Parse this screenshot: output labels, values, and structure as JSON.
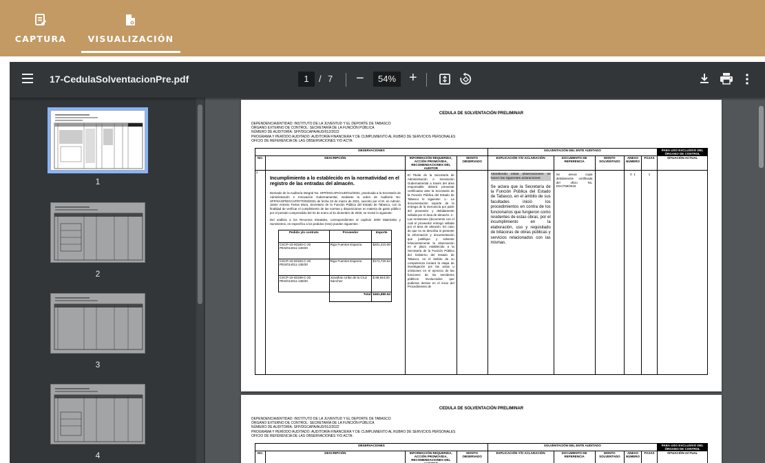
{
  "appbar": {
    "tabs": [
      {
        "label": "CAPTURA",
        "icon": "edit-document-icon",
        "active": false
      },
      {
        "label": "VISUALIZACIÓN",
        "icon": "document-view-icon",
        "active": true
      }
    ],
    "color": "#c39a64"
  },
  "viewer": {
    "filename": "17-CedulaSolventacionPre.pdf",
    "current_page": "1",
    "page_separator": "/",
    "total_pages": "7",
    "zoom": "54%",
    "zoom_out": "−",
    "zoom_in": "+"
  },
  "thumbnails": [
    {
      "number": "1",
      "selected": true
    },
    {
      "number": "2",
      "selected": false
    },
    {
      "number": "3",
      "selected": false
    },
    {
      "number": "4",
      "selected": false
    }
  ],
  "document": {
    "title": "CEDULA DE SOLVENTACIÓN PRELIMINAR",
    "header": [
      "DEPENDENCIA/ENTIDAD: INSTITUTO DE LA JUVENTUD Y EL DEPORTE DE TABASCO",
      "ÓRGANO EXTERNO DE CONTROL: SECRETARÍA DE LA FUNCIÓN PÚBLICA",
      "NÚMERO DE AUDITORÍA: SFP/DGCAPA/AUD/012/2022",
      "PROGRAMA Y PERÍODO AUDITADO: AUDITORÍA FINANCIERA Y DE CUMPLIMIENTO AL RUBRO DE SERVICIOS PERSONALES",
      "OFICIO DE REFERENCIA DE LAS OBSERVACIONES Y/O ACTA:"
    ],
    "columns": {
      "observaciones": "OBSERVACIONES",
      "solventacion": "SOLVENTACIÓN DEL ENTE AUDITADO",
      "exclusivo": "PARA USO EXCLUSIVO DEL ÓRGANO DE CONTROL",
      "no": "NO.",
      "descripcion": "DESCRIPCIÓN",
      "informacion": "INFORMACIÓN REQUERIDA, ACCIÓN PROMOVIDA, RECOMENDACIONES DEL AUDITOR",
      "monto_observado": "MONTO OBSERVADO",
      "explicacion": "EXPLICACIÓN Y/O ACLARACIÓN",
      "documento": "DOCUMENTO DE REFERENCIA",
      "monto_solventado": "MONTO SOLVENTADO",
      "anexo": "ANEXO NÚMERO",
      "fojas": "FOJAS",
      "situacion": "SITUACIÓN ACTUAL"
    },
    "row": {
      "no": "2",
      "heading": "Incumplimiento a lo establecido en la normatividad en el registro de las entradas del almacén.",
      "paragraph1": "Derivado de la Auditoría Integral No. SFP/DGCAPA/AUD/012/2021, practicada a la Secretaría de Administración e Innovación Gubernamental, mediante la orden de Auditoría No. SFP/SAGP/DGCAP/0770/03/2021 de fecha 23 de marzo de 2021, suscrito por el M. en Admón. Jaime Antonio Farías Mora, Secretario de la Función Pública del Estado de Tabasco, con la finalidad de verificar el cumplimiento de las normas y disposiciones en materia de gasto público por el periodo comprendido del 01 de enero al 31 diciembre de 2020, se revisó lo siguiente:",
      "paragraph2": "Del análisis a los Recursos Estatales, correspondientes al capítulo 2000 Materiales y Suministros, en específico a los pedidos (ress) pueden siguientes :",
      "inner_table": {
        "headers": [
          "Pedido y/o contrato",
          "Proveedor",
          "Importe"
        ],
        "rows": [
          [
            "CSCP-10-00180-C-20 PES/014011-130/20",
            "Rigo Fuentes Esparza",
            "$201,210.00"
          ],
          [
            "CSCP-10-00183-C-20 PES/014011-135/20",
            "Rigo Fuentes Esparza",
            "$171,720.64"
          ],
          [
            "CSCP-10-00188-C-20 PES/014011-138/20",
            "Jonathan Uribe de la Cruz Sánchez",
            "$ 88,944.00"
          ]
        ],
        "total_label": "Total",
        "total_value": "$461,880.64"
      },
      "info_text": "El Titular de la Secretaría de Administración e Innovación Gubernamental a través del área responsable deberá presentar certificados ante la Secretaría de la Función Pública del Estado de Tabasco lo siguiente: 1.- La documentación soporte de la entrega de la mercancía por parte del proveedor y debidamente sellada por el área de almacén. 2.- Las remisiones (documento con el cual el proveedor entregó sellada por el área de almacén. En caso de que no se describa ni presente la información y documentación que justifique y solvente fehacientemente la observación en el plazo establecido a la Secretaría de la Función Pública del Gobierno del Estado de Tabasco, en el ámbito de su competencia iniciará la etapa de investigación por las actas u omisiones en el ejercicio de las funciones de los servidores públicos involucrados que pudieran derivar en el inicio del Procedimiento de",
      "explanation_highlight": "Atendiendo estas observaciones se hacen las siguientes aclaraciones:",
      "explanation_text": "Se aclara que la Secretaría de la Función Pública del Estado de Tabasco, en el ámbito de sus facultades inició los procedimientos en contra de los funcionarios que fungieron como residentes de estas obras, por el incumplimiento en la elaboración, uso y requisitado de bitácoras de obras públicas y servicios relacionados con las mismas.",
      "document_ref": "Se anexa copia debidamente certificada del oficio No. DSA/758/2018",
      "anexo": "0",
      "anexo_num": "1",
      "fojas": "1"
    }
  }
}
